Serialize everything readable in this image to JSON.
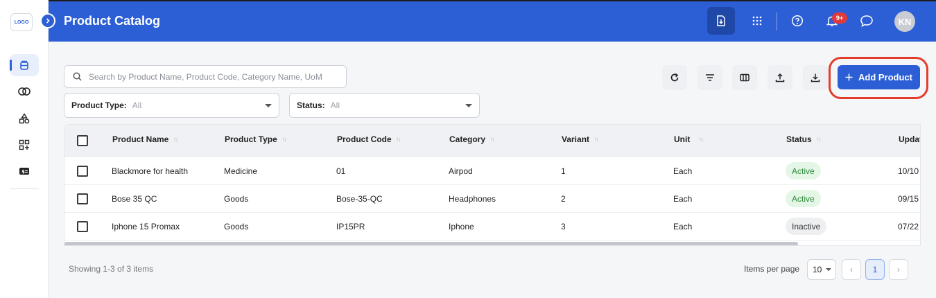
{
  "app": {
    "logo_text": "LOGO",
    "title": "Product Catalog"
  },
  "header": {
    "notification_count": "9+",
    "avatar_initials": "KN"
  },
  "sidebar": {
    "items": [
      {
        "icon": "product-box-icon",
        "active": true
      },
      {
        "icon": "overlap-circles-icon",
        "active": false
      },
      {
        "icon": "shapes-icon",
        "active": false
      },
      {
        "icon": "grid-plus-icon",
        "active": false
      },
      {
        "icon": "price-tag-icon",
        "active": false
      }
    ]
  },
  "search": {
    "placeholder": "Search by Product Name, Product Code, Category Name, UoM",
    "value": ""
  },
  "filters": {
    "product_type": {
      "label": "Product Type:",
      "value": "All"
    },
    "status": {
      "label": "Status:",
      "value": "All"
    }
  },
  "toolbar": {
    "add_label": "Add Product"
  },
  "table": {
    "columns": [
      "Product Name",
      "Product Type",
      "Product Code",
      "Category",
      "Variant",
      "Unit",
      "Status",
      "Updat"
    ],
    "rows": [
      [
        "Blackmore for health",
        "Medicine",
        "01",
        "Airpod",
        "1",
        "Each",
        "Active",
        "10/10"
      ],
      [
        "Bose 35 QC",
        "Goods",
        "Bose-35-QC",
        "Headphones",
        "2",
        "Each",
        "Active",
        "09/15"
      ],
      [
        "Iphone 15 Promax",
        "Goods",
        "IP15PR",
        "Iphone",
        "3",
        "Each",
        "Inactive",
        "07/22"
      ]
    ]
  },
  "footer": {
    "showing": "Showing 1-3 of 3 items",
    "items_per_page_label": "Items per page",
    "items_per_page": "10",
    "prev_glyph": "‹",
    "current_page": "1",
    "next_glyph": "›"
  },
  "colors": {
    "brand": "#2c5fd6",
    "highlight": "#e23d2c",
    "active_status": "#2e8b3c"
  }
}
